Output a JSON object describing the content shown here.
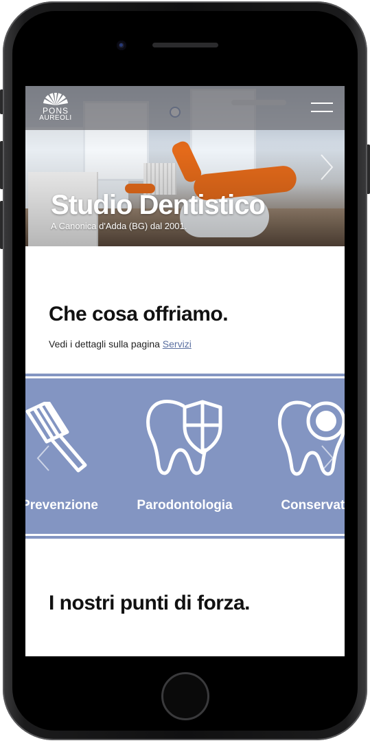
{
  "header": {
    "logo_line1": "PONS",
    "logo_line2": "AUREOLI",
    "menu_icon": "hamburger-menu-icon"
  },
  "hero": {
    "title": "Studio Dentistico",
    "subtitle": "A Canonica d'Adda (BG) dal 2001.",
    "next_icon": "chevron-right-icon"
  },
  "offer": {
    "heading": "Che cosa offriamo.",
    "text": "Vedi i dettagli sulla pagina",
    "link": "Servizi"
  },
  "services": {
    "items": [
      {
        "label": "Prevenzione",
        "icon": "toothbrush-icon"
      },
      {
        "label": "Parodontologia",
        "icon": "tooth-shield-icon"
      },
      {
        "label": "Conservativa",
        "icon": "tooth-cavity-icon"
      }
    ],
    "band_color": "#8395c2"
  },
  "strengths": {
    "heading": "I nostri punti di forza."
  }
}
